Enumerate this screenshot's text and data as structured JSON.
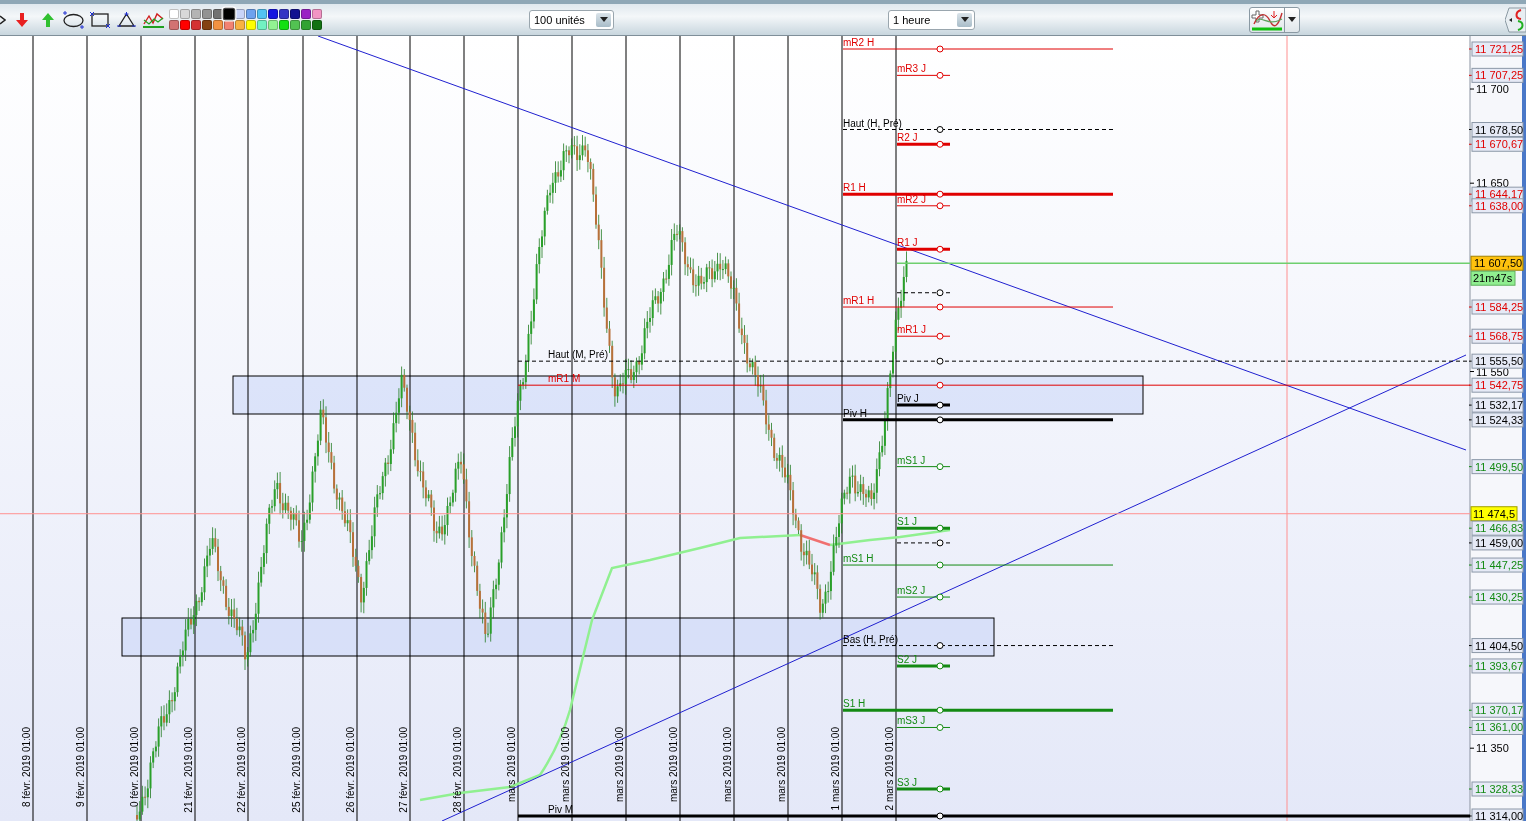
{
  "toolbar": {
    "swatches": [
      {
        "color": "#ffffff",
        "selected": false
      },
      {
        "color": "#d8d8d8",
        "selected": false
      },
      {
        "color": "#b4b4b4",
        "selected": false
      },
      {
        "color": "#939393",
        "selected": false
      },
      {
        "color": "#727272",
        "selected": false
      },
      {
        "color": "#000000",
        "selected": true
      },
      {
        "color": "#c8d4f8",
        "selected": false
      },
      {
        "color": "#6ea2ee",
        "selected": false
      },
      {
        "color": "#52c2f2",
        "selected": false
      },
      {
        "color": "#1414e0",
        "selected": false
      },
      {
        "color": "#3434c4",
        "selected": false
      },
      {
        "color": "#121290",
        "selected": false
      },
      {
        "color": "#9a22c4",
        "selected": false
      },
      {
        "color": "#f294c4",
        "selected": false
      },
      {
        "color": "#d27272",
        "selected": false
      },
      {
        "color": "#ff0000",
        "selected": false
      },
      {
        "color": "#d43232",
        "selected": false
      },
      {
        "color": "#844212",
        "selected": false
      },
      {
        "color": "#f29242",
        "selected": false
      },
      {
        "color": "#f28272",
        "selected": false
      },
      {
        "color": "#f8b242",
        "selected": false
      },
      {
        "color": "#ffff00",
        "selected": false
      },
      {
        "color": "#72f2c2",
        "selected": false
      },
      {
        "color": "#92f292",
        "selected": false
      },
      {
        "color": "#12e012",
        "selected": false
      },
      {
        "color": "#52c252",
        "selected": false
      },
      {
        "color": "#32a232",
        "selected": false
      },
      {
        "color": "#127212",
        "selected": false
      }
    ],
    "units_select": {
      "value": "100 unités"
    },
    "timeframe_select": {
      "value": "1 heure"
    }
  },
  "chart": {
    "dates": [
      "8 févr. 2019 01:00",
      "9 févr. 2019 01:00",
      "0 févr. 2019 01:00",
      "21 févr. 2019 01:00",
      "22 févr. 2019 01:00",
      "25 févr. 2019 01:00",
      "26 févr. 2019 01:00",
      "27 févr. 2019 01:00",
      "28 févr. 2019 01:00",
      "mars 2019 01:00",
      "mars 2019 01:00",
      "mars 2019 01:00",
      "mars 2019 01:00",
      "mars 2019 01:00",
      "mars 2019 01:00",
      "1 mars 2019 01:00",
      "2 mars 2019 01:00"
    ],
    "ticks": [
      "11 700",
      "11 650",
      "11 550",
      "11 350"
    ],
    "last_price": {
      "price": "11 607,50",
      "timer": "21m47s"
    },
    "cursor": {
      "price": "11 474,5"
    },
    "hourly_levels": [
      {
        "label": "mR2 H",
        "price": "11 721,25",
        "kind": "minor",
        "color": "#e00000"
      },
      {
        "label": "Haut (H, Pré)",
        "price": "11 678,50",
        "kind": "extreme",
        "color": "#000000"
      },
      {
        "label": "R1 H",
        "price": "11 644,17",
        "kind": "major",
        "color": "#e00000"
      },
      {
        "label": "mR1 H",
        "price": "11 584,25",
        "kind": "minor",
        "color": "#e00000"
      },
      {
        "label": "Piv H",
        "price": "11 524,33",
        "kind": "major",
        "color": "#000000"
      },
      {
        "label": "mS1 H",
        "price": "11 447,25",
        "kind": "minor",
        "color": "#138a13"
      },
      {
        "label": "Bas (H, Pré)",
        "price": "11 404,50",
        "kind": "extreme",
        "color": "#000000"
      },
      {
        "label": "S1 H",
        "price": "11 370,17",
        "kind": "major",
        "color": "#138a13"
      }
    ],
    "daily_levels": [
      {
        "label": "mR3 J",
        "price": "11 707,25",
        "kind": "minor",
        "color": "#e00000"
      },
      {
        "label": "R2 J",
        "price": "11 670,67",
        "kind": "major",
        "color": "#e00000"
      },
      {
        "label": "mR2 J",
        "price": "11 638,00",
        "kind": "minor",
        "color": "#e00000"
      },
      {
        "label": "R1 J",
        "kind": "major",
        "color": "#e00000"
      },
      {
        "kind": "extreme"
      },
      {
        "label": "mR1 J",
        "price": "11 568,75",
        "kind": "minor",
        "color": "#e00000"
      },
      {
        "label": "Piv J",
        "price": "11 532,17",
        "kind": "major",
        "color": "#000000"
      },
      {
        "label": "mS1 J",
        "price": "11 499,50",
        "kind": "minor",
        "color": "#138a13"
      },
      {
        "label": "S1 J",
        "price": "11 466,83",
        "kind": "major",
        "color": "#138a13"
      },
      {
        "price": "11 459,00",
        "kind": "extreme",
        "color": "#000000"
      },
      {
        "label": "mS2 J",
        "price": "11 430,25",
        "kind": "minor",
        "color": "#138a13"
      },
      {
        "label": "S2 J",
        "price": "11 393,67",
        "kind": "major",
        "color": "#138a13"
      },
      {
        "label": "mS3 J",
        "price": "11 361,00",
        "kind": "minor",
        "color": "#138a13"
      },
      {
        "label": "S3 J",
        "price": "11 328,33",
        "kind": "major",
        "color": "#138a13"
      }
    ],
    "monthly_levels": [
      {
        "label": "Haut (M, Pré)",
        "price": "11 555,50",
        "kind": "extreme",
        "color": "#000000"
      },
      {
        "label": "mR1 M",
        "price": "11 542,75",
        "kind": "minor",
        "color": "#e00000"
      },
      {
        "label": "Piv M",
        "price": "11 314,00",
        "kind": "major",
        "color": "#000000"
      }
    ]
  }
}
